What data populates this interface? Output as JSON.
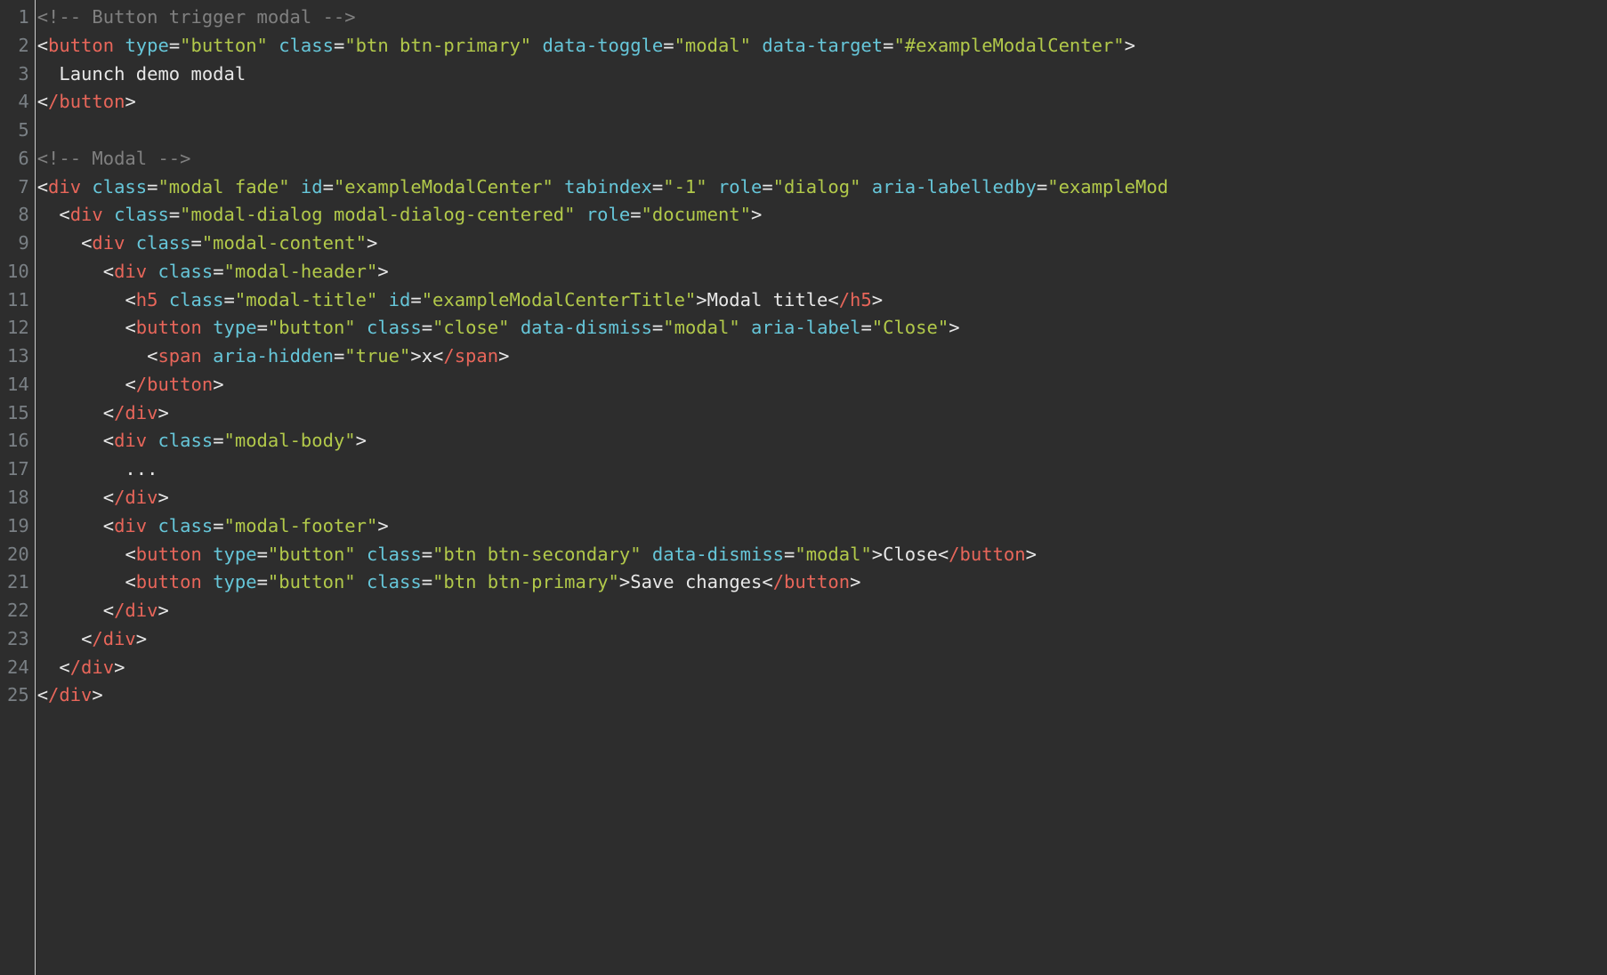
{
  "lines": [
    {
      "n": "1",
      "tokens": [
        [
          "comment",
          "<!-- Button trigger modal -->"
        ]
      ]
    },
    {
      "n": "2",
      "tokens": [
        [
          "punct",
          "<"
        ],
        [
          "tag",
          "button"
        ],
        [
          "text",
          " "
        ],
        [
          "attr",
          "type"
        ],
        [
          "eq",
          "="
        ],
        [
          "string",
          "\"button\""
        ],
        [
          "text",
          " "
        ],
        [
          "attr",
          "class"
        ],
        [
          "eq",
          "="
        ],
        [
          "string",
          "\"btn btn-primary\""
        ],
        [
          "text",
          " "
        ],
        [
          "attr",
          "data-toggle"
        ],
        [
          "eq",
          "="
        ],
        [
          "string",
          "\"modal\""
        ],
        [
          "text",
          " "
        ],
        [
          "attr",
          "data-target"
        ],
        [
          "eq",
          "="
        ],
        [
          "string",
          "\"#exampleModalCenter\""
        ],
        [
          "punct",
          ">"
        ]
      ]
    },
    {
      "n": "3",
      "tokens": [
        [
          "text",
          "  Launch demo modal"
        ]
      ]
    },
    {
      "n": "4",
      "tokens": [
        [
          "punct",
          "<"
        ],
        [
          "tag",
          "/button"
        ],
        [
          "punct",
          ">"
        ]
      ]
    },
    {
      "n": "5",
      "tokens": [
        [
          "text",
          ""
        ]
      ]
    },
    {
      "n": "6",
      "tokens": [
        [
          "comment",
          "<!-- Modal -->"
        ]
      ]
    },
    {
      "n": "7",
      "tokens": [
        [
          "punct",
          "<"
        ],
        [
          "tag",
          "div"
        ],
        [
          "text",
          " "
        ],
        [
          "attr",
          "class"
        ],
        [
          "eq",
          "="
        ],
        [
          "string",
          "\"modal fade\""
        ],
        [
          "text",
          " "
        ],
        [
          "attr",
          "id"
        ],
        [
          "eq",
          "="
        ],
        [
          "string",
          "\"exampleModalCenter\""
        ],
        [
          "text",
          " "
        ],
        [
          "attr",
          "tabindex"
        ],
        [
          "eq",
          "="
        ],
        [
          "string",
          "\"-1\""
        ],
        [
          "text",
          " "
        ],
        [
          "attr",
          "role"
        ],
        [
          "eq",
          "="
        ],
        [
          "string",
          "\"dialog\""
        ],
        [
          "text",
          " "
        ],
        [
          "attr",
          "aria-labelledby"
        ],
        [
          "eq",
          "="
        ],
        [
          "string",
          "\"exampleMod"
        ]
      ]
    },
    {
      "n": "8",
      "tokens": [
        [
          "text",
          "  "
        ],
        [
          "punct",
          "<"
        ],
        [
          "tag",
          "div"
        ],
        [
          "text",
          " "
        ],
        [
          "attr",
          "class"
        ],
        [
          "eq",
          "="
        ],
        [
          "string",
          "\"modal-dialog modal-dialog-centered\""
        ],
        [
          "text",
          " "
        ],
        [
          "attr",
          "role"
        ],
        [
          "eq",
          "="
        ],
        [
          "string",
          "\"document\""
        ],
        [
          "punct",
          ">"
        ]
      ]
    },
    {
      "n": "9",
      "tokens": [
        [
          "text",
          "    "
        ],
        [
          "punct",
          "<"
        ],
        [
          "tag",
          "div"
        ],
        [
          "text",
          " "
        ],
        [
          "attr",
          "class"
        ],
        [
          "eq",
          "="
        ],
        [
          "string",
          "\"modal-content\""
        ],
        [
          "punct",
          ">"
        ]
      ]
    },
    {
      "n": "10",
      "tokens": [
        [
          "text",
          "      "
        ],
        [
          "punct",
          "<"
        ],
        [
          "tag",
          "div"
        ],
        [
          "text",
          " "
        ],
        [
          "attr",
          "class"
        ],
        [
          "eq",
          "="
        ],
        [
          "string",
          "\"modal-header\""
        ],
        [
          "punct",
          ">"
        ]
      ]
    },
    {
      "n": "11",
      "tokens": [
        [
          "text",
          "        "
        ],
        [
          "punct",
          "<"
        ],
        [
          "tag",
          "h5"
        ],
        [
          "text",
          " "
        ],
        [
          "attr",
          "class"
        ],
        [
          "eq",
          "="
        ],
        [
          "string",
          "\"modal-title\""
        ],
        [
          "text",
          " "
        ],
        [
          "attr",
          "id"
        ],
        [
          "eq",
          "="
        ],
        [
          "string",
          "\"exampleModalCenterTitle\""
        ],
        [
          "punct",
          ">"
        ],
        [
          "text",
          "Modal title"
        ],
        [
          "punct",
          "<"
        ],
        [
          "tag",
          "/h5"
        ],
        [
          "punct",
          ">"
        ]
      ]
    },
    {
      "n": "12",
      "tokens": [
        [
          "text",
          "        "
        ],
        [
          "punct",
          "<"
        ],
        [
          "tag",
          "button"
        ],
        [
          "text",
          " "
        ],
        [
          "attr",
          "type"
        ],
        [
          "eq",
          "="
        ],
        [
          "string",
          "\"button\""
        ],
        [
          "text",
          " "
        ],
        [
          "attr",
          "class"
        ],
        [
          "eq",
          "="
        ],
        [
          "string",
          "\"close\""
        ],
        [
          "text",
          " "
        ],
        [
          "attr",
          "data-dismiss"
        ],
        [
          "eq",
          "="
        ],
        [
          "string",
          "\"modal\""
        ],
        [
          "text",
          " "
        ],
        [
          "attr",
          "aria-label"
        ],
        [
          "eq",
          "="
        ],
        [
          "string",
          "\"Close\""
        ],
        [
          "punct",
          ">"
        ]
      ]
    },
    {
      "n": "13",
      "tokens": [
        [
          "text",
          "          "
        ],
        [
          "punct",
          "<"
        ],
        [
          "tag",
          "span"
        ],
        [
          "text",
          " "
        ],
        [
          "attr",
          "aria-hidden"
        ],
        [
          "eq",
          "="
        ],
        [
          "string",
          "\"true\""
        ],
        [
          "punct",
          ">"
        ],
        [
          "text",
          "x"
        ],
        [
          "punct",
          "<"
        ],
        [
          "tag",
          "/span"
        ],
        [
          "punct",
          ">"
        ]
      ]
    },
    {
      "n": "14",
      "tokens": [
        [
          "text",
          "        "
        ],
        [
          "punct",
          "<"
        ],
        [
          "tag",
          "/button"
        ],
        [
          "punct",
          ">"
        ]
      ]
    },
    {
      "n": "15",
      "tokens": [
        [
          "text",
          "      "
        ],
        [
          "punct",
          "<"
        ],
        [
          "tag",
          "/div"
        ],
        [
          "punct",
          ">"
        ]
      ]
    },
    {
      "n": "16",
      "tokens": [
        [
          "text",
          "      "
        ],
        [
          "punct",
          "<"
        ],
        [
          "tag",
          "div"
        ],
        [
          "text",
          " "
        ],
        [
          "attr",
          "class"
        ],
        [
          "eq",
          "="
        ],
        [
          "string",
          "\"modal-body\""
        ],
        [
          "punct",
          ">"
        ]
      ]
    },
    {
      "n": "17",
      "tokens": [
        [
          "text",
          "        ..."
        ]
      ]
    },
    {
      "n": "18",
      "tokens": [
        [
          "text",
          "      "
        ],
        [
          "punct",
          "<"
        ],
        [
          "tag",
          "/div"
        ],
        [
          "punct",
          ">"
        ]
      ]
    },
    {
      "n": "19",
      "tokens": [
        [
          "text",
          "      "
        ],
        [
          "punct",
          "<"
        ],
        [
          "tag",
          "div"
        ],
        [
          "text",
          " "
        ],
        [
          "attr",
          "class"
        ],
        [
          "eq",
          "="
        ],
        [
          "string",
          "\"modal-footer\""
        ],
        [
          "punct",
          ">"
        ]
      ]
    },
    {
      "n": "20",
      "tokens": [
        [
          "text",
          "        "
        ],
        [
          "punct",
          "<"
        ],
        [
          "tag",
          "button"
        ],
        [
          "text",
          " "
        ],
        [
          "attr",
          "type"
        ],
        [
          "eq",
          "="
        ],
        [
          "string",
          "\"button\""
        ],
        [
          "text",
          " "
        ],
        [
          "attr",
          "class"
        ],
        [
          "eq",
          "="
        ],
        [
          "string",
          "\"btn btn-secondary\""
        ],
        [
          "text",
          " "
        ],
        [
          "attr",
          "data-dismiss"
        ],
        [
          "eq",
          "="
        ],
        [
          "string",
          "\"modal\""
        ],
        [
          "punct",
          ">"
        ],
        [
          "text",
          "Close"
        ],
        [
          "punct",
          "<"
        ],
        [
          "tag",
          "/button"
        ],
        [
          "punct",
          ">"
        ]
      ]
    },
    {
      "n": "21",
      "tokens": [
        [
          "text",
          "        "
        ],
        [
          "punct",
          "<"
        ],
        [
          "tag",
          "button"
        ],
        [
          "text",
          " "
        ],
        [
          "attr",
          "type"
        ],
        [
          "eq",
          "="
        ],
        [
          "string",
          "\"button\""
        ],
        [
          "text",
          " "
        ],
        [
          "attr",
          "class"
        ],
        [
          "eq",
          "="
        ],
        [
          "string",
          "\"btn btn-primary\""
        ],
        [
          "punct",
          ">"
        ],
        [
          "text",
          "Save changes"
        ],
        [
          "punct",
          "<"
        ],
        [
          "tag",
          "/button"
        ],
        [
          "punct",
          ">"
        ]
      ]
    },
    {
      "n": "22",
      "tokens": [
        [
          "text",
          "      "
        ],
        [
          "punct",
          "<"
        ],
        [
          "tag",
          "/div"
        ],
        [
          "punct",
          ">"
        ]
      ]
    },
    {
      "n": "23",
      "tokens": [
        [
          "text",
          "    "
        ],
        [
          "punct",
          "<"
        ],
        [
          "tag",
          "/div"
        ],
        [
          "punct",
          ">"
        ]
      ]
    },
    {
      "n": "24",
      "tokens": [
        [
          "text",
          "  "
        ],
        [
          "punct",
          "<"
        ],
        [
          "tag",
          "/div"
        ],
        [
          "punct",
          ">"
        ]
      ]
    },
    {
      "n": "25",
      "tokens": [
        [
          "punct",
          "<"
        ],
        [
          "tag",
          "/div"
        ],
        [
          "punct",
          ">"
        ]
      ]
    }
  ]
}
